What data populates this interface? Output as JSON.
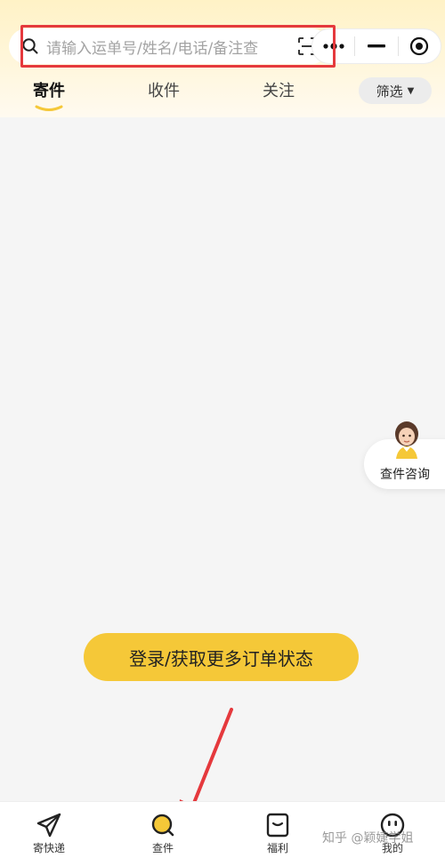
{
  "search": {
    "placeholder": "请输入运单号/姓名/电话/备注查",
    "icon": "search-icon",
    "scan_icon": "scan-icon"
  },
  "capsule": {
    "more_icon": "more-icon",
    "minimize_icon": "minimize-icon",
    "close_icon": "target-icon"
  },
  "tabs": [
    {
      "label": "寄件",
      "active": true
    },
    {
      "label": "收件",
      "active": false
    },
    {
      "label": "关注",
      "active": false
    }
  ],
  "filter": {
    "label": "筛选"
  },
  "help": {
    "label": "查件咨询"
  },
  "login_button": {
    "label": "登录/获取更多订单状态"
  },
  "tabbar": [
    {
      "label": "寄快递",
      "icon": "paper-plane-icon"
    },
    {
      "label": "查件",
      "icon": "search-icon"
    },
    {
      "label": "福利",
      "icon": "gift-bag-icon"
    },
    {
      "label": "我的",
      "icon": "face-icon"
    }
  ],
  "watermark": "知乎 @颖婕学姐",
  "colors": {
    "accent": "#f5c838",
    "highlight": "#e5393d",
    "header_bg": "#fff2c6"
  }
}
